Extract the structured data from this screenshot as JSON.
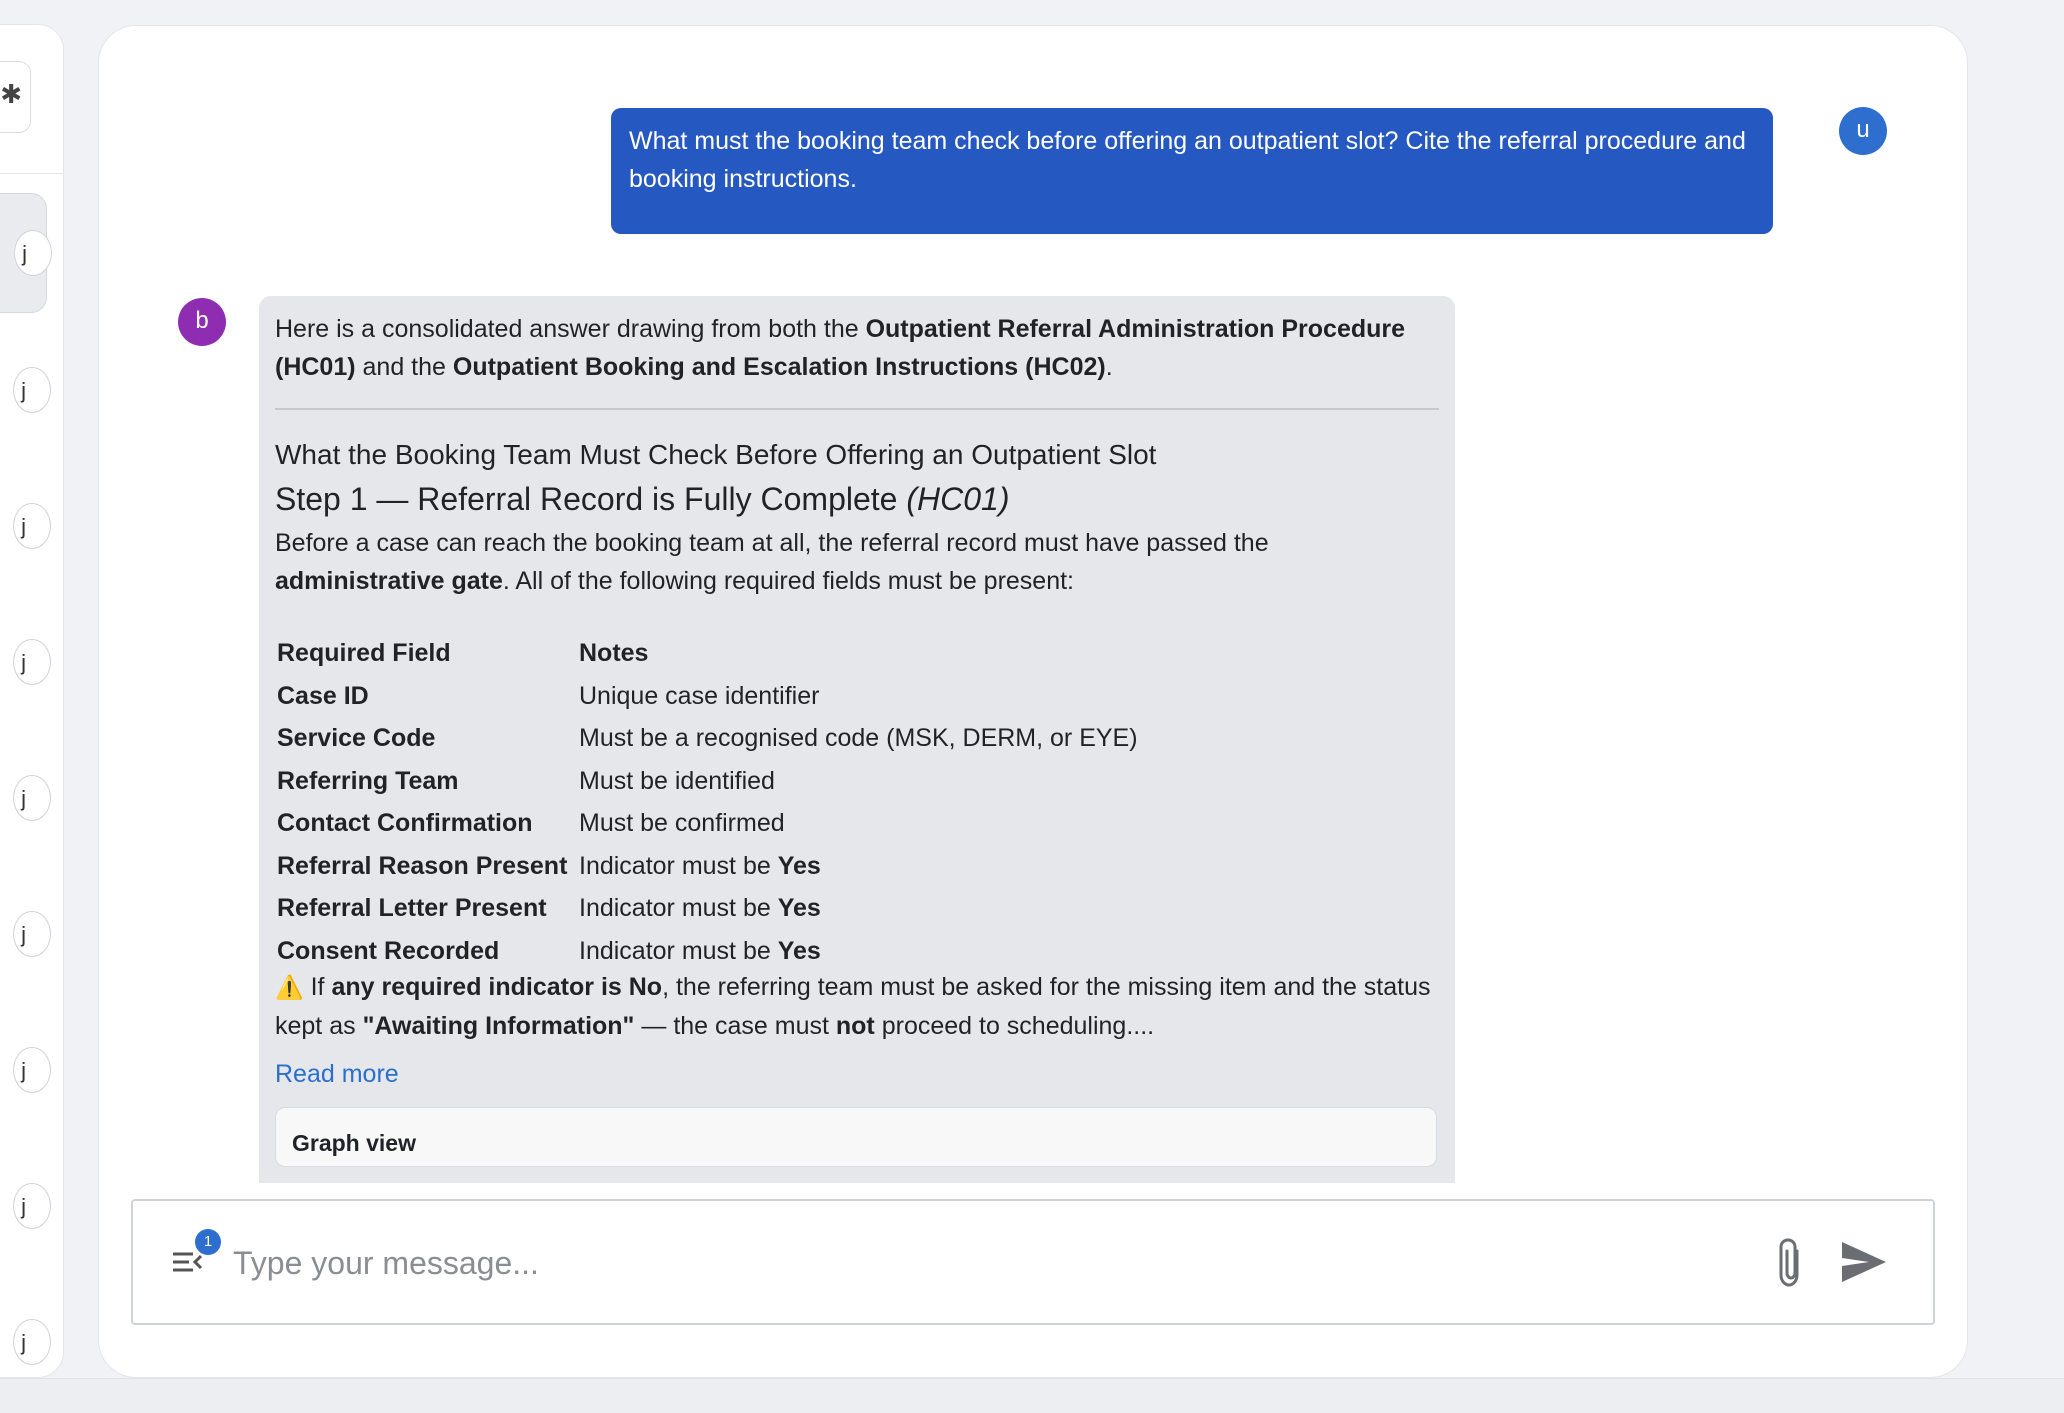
{
  "sidebar": {
    "top_button_icon": "gear-icon",
    "conversation_count": 9
  },
  "chat": {
    "user_avatar": "u",
    "bot_avatar": "b",
    "user_message": "What must the booking team check before offering an outpatient slot? Cite the referral procedure and booking instructions.",
    "bot": {
      "intro_1": "Here is a consolidated answer drawing from both the ",
      "intro_doc1": "Outpatient Referral Administration Procedure (HC01)",
      "intro_2": " and the ",
      "intro_doc2": "Outpatient Booking and Escalation Instructions (HC02)",
      "intro_3": ".",
      "heading": "What the Booking Team Must Check Before Offering an Outpatient Slot",
      "step_title": "Step 1 — Referral Record is Fully Complete ",
      "step_ref": "(HC01)",
      "para_1": "Before a case can reach the booking team at all, the referral record must have passed the ",
      "para_bold": "administrative gate",
      "para_2": ". All of the following required fields must be present:",
      "table": {
        "headers": [
          "Required Field",
          "Notes"
        ],
        "rows": [
          {
            "field": "Case ID",
            "note": "Unique case identifier",
            "bold": ""
          },
          {
            "field": "Service Code",
            "note": "Must be a recognised code (MSK, DERM, or EYE)",
            "bold": ""
          },
          {
            "field": "Referring Team",
            "note": "Must be identified",
            "bold": ""
          },
          {
            "field": "Contact Confirmation",
            "note": "Must be confirmed",
            "bold": ""
          },
          {
            "field": "Referral Reason Present",
            "note": "Indicator must be ",
            "bold": "Yes"
          },
          {
            "field": "Referral Letter Present",
            "note": "Indicator must be ",
            "bold": "Yes"
          },
          {
            "field": "Consent Recorded",
            "note": "Indicator must be ",
            "bold": "Yes"
          }
        ]
      },
      "warning": {
        "icon": "⚠️",
        "t1": " If ",
        "b1": "any required indicator is No",
        "t2": ", the referring team must be asked for the missing item and the status kept as ",
        "b2": "\"Awaiting Information\"",
        "t3": " — the case must ",
        "b3": "not",
        "t4": " proceed to scheduling...."
      },
      "read_more": "Read more",
      "graph_view": "Graph view"
    }
  },
  "composer": {
    "placeholder": "Type your message...",
    "badge_count": "1"
  }
}
